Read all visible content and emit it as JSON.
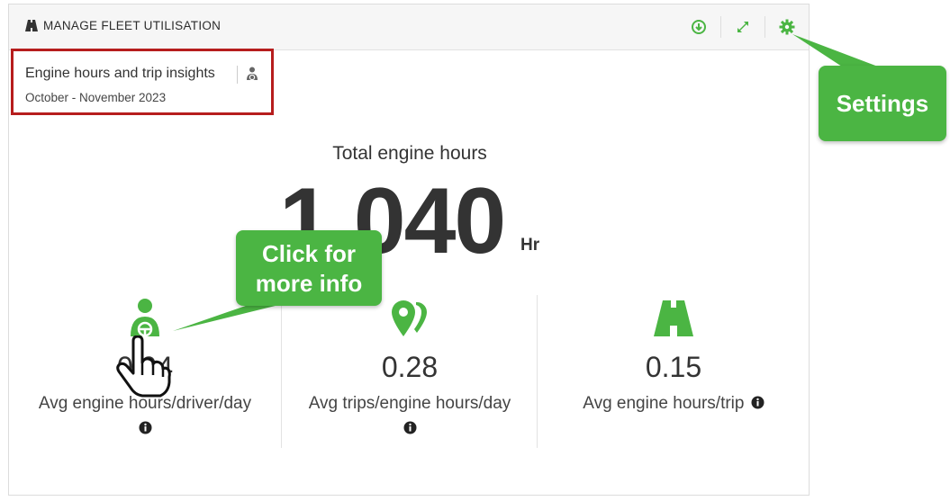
{
  "header": {
    "title": "MANAGE FLEET UTILISATION",
    "icons": [
      "road-icon",
      "download-icon",
      "expand-icon",
      "gear-icon"
    ]
  },
  "insight": {
    "title": "Engine hours and trip insights",
    "subtitle": "October - November 2023",
    "icon": "driver-icon"
  },
  "total": {
    "label": "Total engine hours",
    "value": "1,040",
    "unit": "Hr"
  },
  "metrics": [
    {
      "icon": "driver-icon",
      "value": "0.94",
      "label": "Avg engine hours/driver/day"
    },
    {
      "icon": "location-pin-icon",
      "value": "0.28",
      "label": "Avg trips/engine hours/day"
    },
    {
      "icon": "road-icon",
      "value": "0.15",
      "label": "Avg engine hours/trip"
    }
  ],
  "callouts": {
    "settings": "Settings",
    "click_line1": "Click for",
    "click_line2": "more info"
  },
  "colors": {
    "accent": "#4bb543",
    "highlight_border": "#b61d1d",
    "callout": "#4bb543"
  }
}
